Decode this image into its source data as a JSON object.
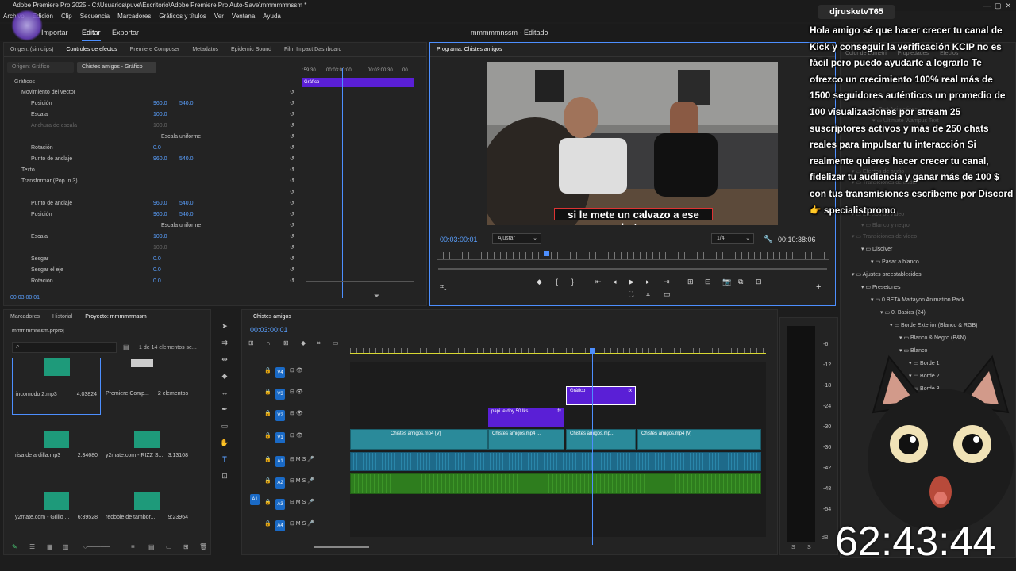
{
  "titlebar": {
    "title": "Adobe Premiere Pro 2025 - C:\\Usuarios\\puve\\Escritorio\\Adobe Premiere Pro Auto-Save\\mmmmmnssm *"
  },
  "menu": [
    "Archivo",
    "Edición",
    "Clip",
    "Secuencia",
    "Marcadores",
    "Gráficos y títulos",
    "Ver",
    "Ventana",
    "Ayuda"
  ],
  "workspaces": {
    "importar": "Importar",
    "editar": "Editar",
    "exportar": "Exportar",
    "center_title": "mmmmmnssm - Editado"
  },
  "effect_tabs": [
    "Origen: (sin clips)",
    "Controles de efectos",
    "Premiere Composer",
    "Metadatos",
    "Epidemic Sound",
    "Film Impact Dashboard"
  ],
  "effect_controls": {
    "source_label": "Origen: Gráfico",
    "clip_label": "Chistes amigos - Gráfico",
    "ruler_times": [
      ":59:30",
      "00:03:00:00",
      "00:03:00:30",
      "00"
    ],
    "graphic_bar": "Gráfico",
    "section": "Gráficos",
    "rows": [
      {
        "label": "Movimiento del vector",
        "v1": "",
        "v2": ""
      },
      {
        "label": "Posición",
        "v1": "960.0",
        "v2": "540.0"
      },
      {
        "label": "Escala",
        "v1": "100.0",
        "v2": ""
      },
      {
        "label": "Anchura de escala",
        "v1": "100.0",
        "v2": ""
      },
      {
        "label": "Escala uniforme",
        "v1": "",
        "v2": ""
      },
      {
        "label": "Rotación",
        "v1": "0.0",
        "v2": ""
      },
      {
        "label": "Punto de anclaje",
        "v1": "960.0",
        "v2": "540.0"
      },
      {
        "label": "Texto",
        "v1": "",
        "v2": ""
      },
      {
        "label": "Transformar (Pop In 3)",
        "v1": "",
        "v2": ""
      },
      {
        "label": "",
        "v1": "",
        "v2": ""
      },
      {
        "label": "Punto de anclaje",
        "v1": "960.0",
        "v2": "540.0"
      },
      {
        "label": "Posición",
        "v1": "960.0",
        "v2": "540.0"
      },
      {
        "label": "Escala uniforme",
        "v1": "",
        "v2": ""
      },
      {
        "label": "Escala",
        "v1": "100.0",
        "v2": ""
      },
      {
        "label": "",
        "v1": "100.0",
        "v2": ""
      },
      {
        "label": "Sesgar",
        "v1": "0.0",
        "v2": ""
      },
      {
        "label": "Sesgar el eje",
        "v1": "0.0",
        "v2": ""
      },
      {
        "label": "Rotación",
        "v1": "0.0",
        "v2": ""
      }
    ],
    "timecode": "00:03:00:01"
  },
  "program": {
    "tab": "Programa: Chistes amigos",
    "subtitle": "si le mete un calvazo a ese hpta.",
    "timecode": "00:03:00:01",
    "fit": "Ajustar",
    "res": "1/4",
    "duration": "00:10:38:06"
  },
  "project": {
    "tabs": [
      "Marcadores",
      "Historial",
      "Proyecto: mmmmmnssm"
    ],
    "file": "mmmmmnssm.prproj",
    "count": "1 de 14 elementos se...",
    "items": [
      {
        "name": "incomodo 2.mp3",
        "dur": "4:03824"
      },
      {
        "name": "Premiere Comp...",
        "dur": "2 elementos"
      },
      {
        "name": "risa de ardilla.mp3",
        "dur": "2:34680"
      },
      {
        "name": "y2mate.com - RIZZ S...",
        "dur": "3:13108"
      },
      {
        "name": "y2mate.com - Grillo ...",
        "dur": "6:39528"
      },
      {
        "name": "redoble de tambor...",
        "dur": "9:23964"
      }
    ]
  },
  "timeline": {
    "tab": "Chistes amigos",
    "timecode": "00:03:00:01",
    "tracks": [
      "V4",
      "V3",
      "V2",
      "V1",
      "A1",
      "A2",
      "A3",
      "A4"
    ],
    "source_patch": "A1",
    "clips": {
      "grafico": "Gráfico",
      "papi": "papi le doy 50 lks",
      "v1a": "Chistes amigos.mp4 [V]",
      "v1b": "Chistes amigos.mp4 ...",
      "v1c": "Chistes amigos.mp...",
      "v1d": "Chistes amigos.mp4 [V]"
    },
    "fx": "fx",
    "meter_labels": [
      "-6",
      "-12",
      "-18",
      "-24",
      "-30",
      "-36",
      "-42",
      "-48",
      "-54"
    ],
    "meter_db": "dB",
    "meter_s": "S"
  },
  "right_panel": {
    "tabs": [
      "Color de Lumetri",
      "Propiedades",
      "Efectos"
    ],
    "items": [
      "Text Animations",
      "Ultimate Wampus Text",
      "Efectos de audio",
      "Transiciones de audio",
      "Efectos de vídeo",
      "Blanco y negro",
      "Transiciones de vídeo",
      "Disolver",
      "Pasar a blanco",
      "Ajustes preestablecidos",
      "Presetones",
      "0 BETA Mattayon Animation Pack",
      "0. Basics (24)",
      "Borde Exterior (Blanco & RGB)",
      "Blanco & Negro (B&N)",
      "Blanco",
      "Borde 1",
      "Borde 2",
      "Borde 3"
    ]
  },
  "stream": {
    "username": "djrusketvT65",
    "message": "Hola amigo sé que hacer crecer tu canal de Kick y conseguir la verificación KCIP no es fácil pero puedo ayudarte a lograrlo Te ofrezco un crecimiento 100% real más de 1500 seguidores auténticos un promedio de 100 visualizaciones por stream 25 suscriptores activos y más de 250 chats reales para impulsar tu interacción Si realmente quieres hacer crecer tu canal, fidelizar tu audiencia y ganar más de 100 $ con tus transmisiones escríbeme por Discord👉 specialistpromo",
    "timer": "62:43:44"
  },
  "colors": {
    "accent": "#4d8fff",
    "graphic_clip": "#5a1fd6",
    "video_clip": "#2a8a9a",
    "audio_clip": "#2e7d1e",
    "playhead": "#4d8fff"
  }
}
